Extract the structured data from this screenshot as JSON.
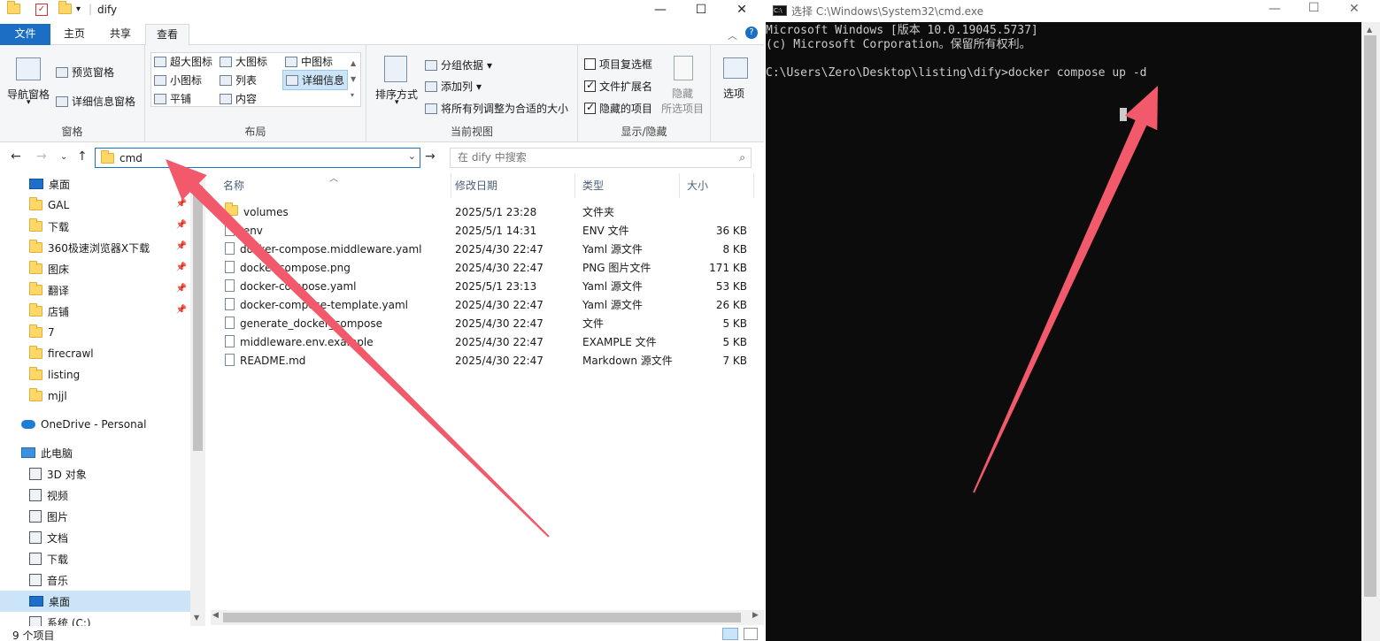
{
  "explorer": {
    "window_title": "dify",
    "window_buttons": {
      "minimize": "—",
      "maximize": "☐",
      "close": "✕"
    },
    "tabs": [
      {
        "label": "文件"
      },
      {
        "label": "主页"
      },
      {
        "label": "共享"
      },
      {
        "label": "查看"
      }
    ],
    "ribbon": {
      "panes": {
        "label": "窗格",
        "nav_pane": "导航窗格",
        "preview_pane": "预览窗格",
        "details_pane": "详细信息窗格"
      },
      "layout": {
        "label": "布局",
        "options": [
          "超大图标",
          "大图标",
          "中图标",
          "小图标",
          "列表",
          "详细信息",
          "平铺",
          "内容"
        ],
        "selected": "详细信息"
      },
      "current_view": {
        "label": "当前视图",
        "sort_by": "排序方式",
        "group_by": "分组依据",
        "add_columns": "添加列",
        "fit_columns": "将所有列调整为合适的大小"
      },
      "show_hide": {
        "label": "显示/隐藏",
        "item_checkboxes": "项目复选框",
        "item_checkboxes_checked": false,
        "file_extensions": "文件扩展名",
        "file_extensions_checked": true,
        "hidden_items": "隐藏的项目",
        "hidden_items_checked": true,
        "hide_selected": "隐藏",
        "hide_selected_2": "所选项目",
        "options": "选项"
      }
    },
    "address": {
      "value": "cmd",
      "search_placeholder": "在 dify 中搜索"
    },
    "nav": {
      "quick_access": [
        {
          "label": "桌面",
          "pinned": true,
          "icon": "desktop-icon"
        },
        {
          "label": "GAL",
          "pinned": true,
          "icon": "folder-icon"
        },
        {
          "label": "下载",
          "pinned": true,
          "icon": "folder-icon"
        },
        {
          "label": "360极速浏览器X下载",
          "pinned": true,
          "icon": "folder-icon"
        },
        {
          "label": "图床",
          "pinned": true,
          "icon": "folder-icon"
        },
        {
          "label": "翻译",
          "pinned": true,
          "icon": "folder-icon"
        },
        {
          "label": "店铺",
          "pinned": true,
          "icon": "folder-icon"
        },
        {
          "label": "7",
          "pinned": false,
          "icon": "folder-icon"
        },
        {
          "label": "firecrawl",
          "pinned": false,
          "icon": "folder-icon"
        },
        {
          "label": "listing",
          "pinned": false,
          "icon": "folder-icon"
        },
        {
          "label": "mjjl",
          "pinned": false,
          "icon": "folder-icon"
        }
      ],
      "onedrive": "OneDrive - Personal",
      "this_pc": "此电脑",
      "pc_items": [
        {
          "label": "3D 对象",
          "icon": "3d-objects-icon"
        },
        {
          "label": "视频",
          "icon": "video-icon"
        },
        {
          "label": "图片",
          "icon": "pictures-icon"
        },
        {
          "label": "文档",
          "icon": "documents-icon"
        },
        {
          "label": "下载",
          "icon": "download-icon"
        },
        {
          "label": "音乐",
          "icon": "music-icon"
        },
        {
          "label": "桌面",
          "icon": "desktop-icon"
        },
        {
          "label": "系统 (C:)",
          "icon": "drive-icon"
        }
      ]
    },
    "columns": {
      "name": "名称",
      "date": "修改日期",
      "type": "类型",
      "size": "大小"
    },
    "files": [
      {
        "name": "volumes",
        "date": "2025/5/1 23:28",
        "type": "文件夹",
        "size": "",
        "icon": "folder-icon"
      },
      {
        "name": ".env",
        "date": "2025/5/1 14:31",
        "type": "ENV 文件",
        "size": "36 KB",
        "icon": "file-icon"
      },
      {
        "name": "docker-compose.middleware.yaml",
        "date": "2025/4/30 22:47",
        "type": "Yaml 源文件",
        "size": "8 KB",
        "icon": "yaml-file-icon"
      },
      {
        "name": "docker-compose.png",
        "date": "2025/4/30 22:47",
        "type": "PNG 图片文件",
        "size": "171 KB",
        "icon": "png-file-icon"
      },
      {
        "name": "docker-compose.yaml",
        "date": "2025/5/1 23:13",
        "type": "Yaml 源文件",
        "size": "53 KB",
        "icon": "yaml-file-icon"
      },
      {
        "name": "docker-compose-template.yaml",
        "date": "2025/4/30 22:47",
        "type": "Yaml 源文件",
        "size": "26 KB",
        "icon": "yaml-file-icon"
      },
      {
        "name": "generate_docker_compose",
        "date": "2025/4/30 22:47",
        "type": "文件",
        "size": "5 KB",
        "icon": "file-icon"
      },
      {
        "name": "middleware.env.example",
        "date": "2025/4/30 22:47",
        "type": "EXAMPLE 文件",
        "size": "5 KB",
        "icon": "file-icon"
      },
      {
        "name": "README.md",
        "date": "2025/4/30 22:47",
        "type": "Markdown 源文件",
        "size": "7 KB",
        "icon": "markdown-file-icon"
      }
    ],
    "status": "9 个项目"
  },
  "cmd": {
    "title": "选择 C:\\Windows\\System32\\cmd.exe",
    "lines": [
      "Microsoft Windows [版本 10.0.19045.5737]",
      "(c) Microsoft Corporation。保留所有权利。",
      "",
      "C:\\Users\\Zero\\Desktop\\listing\\dify>docker compose up -d"
    ]
  },
  "annotation_color": "#f2596a"
}
